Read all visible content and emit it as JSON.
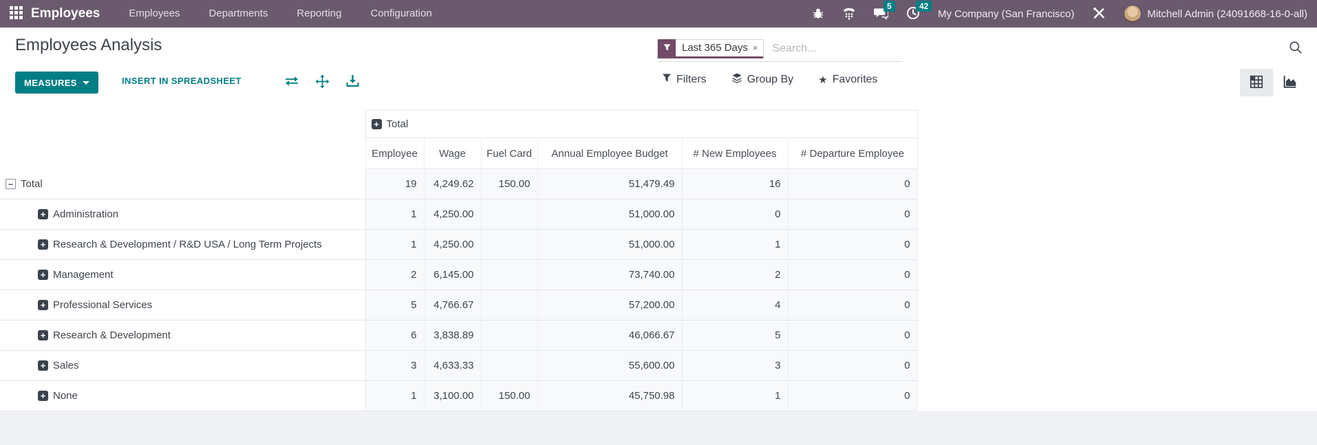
{
  "nav": {
    "app_name": "Employees",
    "menu_items": [
      "Employees",
      "Departments",
      "Reporting",
      "Configuration"
    ],
    "badges": {
      "messages": "5",
      "activities": "42"
    },
    "company": "My Company (San Francisco)",
    "user": "Mitchell Admin (24091668-16-0-all)"
  },
  "control_panel": {
    "title": "Employees Analysis",
    "measures_label": "MEASURES",
    "insert_label": "INSERT IN SPREADSHEET",
    "search": {
      "facet_label": "Last 365 Days",
      "facet_remove": "×",
      "placeholder": "Search..."
    },
    "filters_label": "Filters",
    "group_by_label": "Group By",
    "favorites_label": "Favorites",
    "favorites_star": "★"
  },
  "icons": {
    "apps": "grid-icon",
    "bug": "bug-icon",
    "dialer": "phone-dialer-icon",
    "messages": "chat-icon",
    "activities": "clock-icon",
    "tools": "tools-icon",
    "facet": "funnel-icon",
    "filters": "funnel-icon",
    "group_by": "layers-icon",
    "favorites": "star-icon",
    "search": "magnifier-icon",
    "flip_axis": "flip-axis-icon",
    "expand_all": "expand-all-icon",
    "download": "download-icon",
    "pivot_view": "pivot-grid-icon",
    "graph_view": "area-chart-icon"
  },
  "colors": {
    "navbar": "#6b5a6e",
    "brand_purple": "#714b67",
    "accent_teal": "#017e84",
    "badge": "#017e84",
    "cell_bg": "#f8f9fb",
    "page_bg": "#f0f1f5",
    "text_dark": "#3f454d"
  },
  "pivot": {
    "col_group_header": "Total",
    "expand_glyph": "+",
    "collapse_glyph": "−",
    "columns": [
      "Employee",
      "Wage",
      "Fuel Card",
      "Annual Employee Budget",
      "# New Employees",
      "# Departure Employee"
    ],
    "rows": [
      {
        "label": "Total",
        "expanded": true,
        "indent": 0,
        "values": [
          "19",
          "4,249.62",
          "150.00",
          "51,479.49",
          "16",
          "0"
        ]
      },
      {
        "label": "Administration",
        "expanded": false,
        "indent": 1,
        "values": [
          "1",
          "4,250.00",
          "",
          "51,000.00",
          "0",
          "0"
        ]
      },
      {
        "label": "Research & Development / R&D USA / Long Term Projects",
        "expanded": false,
        "indent": 1,
        "values": [
          "1",
          "4,250.00",
          "",
          "51,000.00",
          "1",
          "0"
        ]
      },
      {
        "label": "Management",
        "expanded": false,
        "indent": 1,
        "values": [
          "2",
          "6,145.00",
          "",
          "73,740.00",
          "2",
          "0"
        ]
      },
      {
        "label": "Professional Services",
        "expanded": false,
        "indent": 1,
        "values": [
          "5",
          "4,766.67",
          "",
          "57,200.00",
          "4",
          "0"
        ]
      },
      {
        "label": "Research & Development",
        "expanded": false,
        "indent": 1,
        "values": [
          "6",
          "3,838.89",
          "",
          "46,066.67",
          "5",
          "0"
        ]
      },
      {
        "label": "Sales",
        "expanded": false,
        "indent": 1,
        "values": [
          "3",
          "4,633.33",
          "",
          "55,600.00",
          "3",
          "0"
        ]
      },
      {
        "label": "None",
        "expanded": false,
        "indent": 1,
        "values": [
          "1",
          "3,100.00",
          "150.00",
          "45,750.98",
          "1",
          "0"
        ]
      }
    ]
  }
}
